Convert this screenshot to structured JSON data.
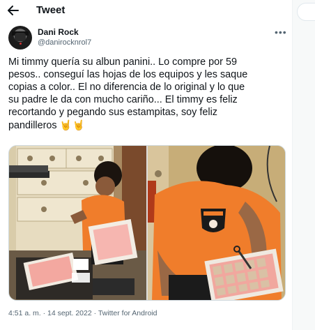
{
  "header": {
    "title": "Tweet"
  },
  "author": {
    "name": "Dani Rock",
    "handle": "@danirocknrol7"
  },
  "tweet": {
    "lines": [
      "Mi timmy quería su albun panini.. Lo compre por 59",
      "pesos.. conseguí las hojas de los equipos y les saque",
      "copias a color.. El no diferencia de lo original y lo que",
      "su padre le da con mucho cariño... El timmy es feliz",
      "recortando y pegando sus estampitas, soy feliz",
      "pandilleros"
    ],
    "emoji": "🤘🤘"
  },
  "meta": {
    "time": "4:51 a. m.",
    "sep1": " · ",
    "date": "14 sept. 2022",
    "sep2": " · ",
    "source": "Twitter for Android"
  },
  "colors": {
    "accent": "#1d9bf0",
    "muted": "#536471",
    "shirt": "#f07d2b"
  }
}
